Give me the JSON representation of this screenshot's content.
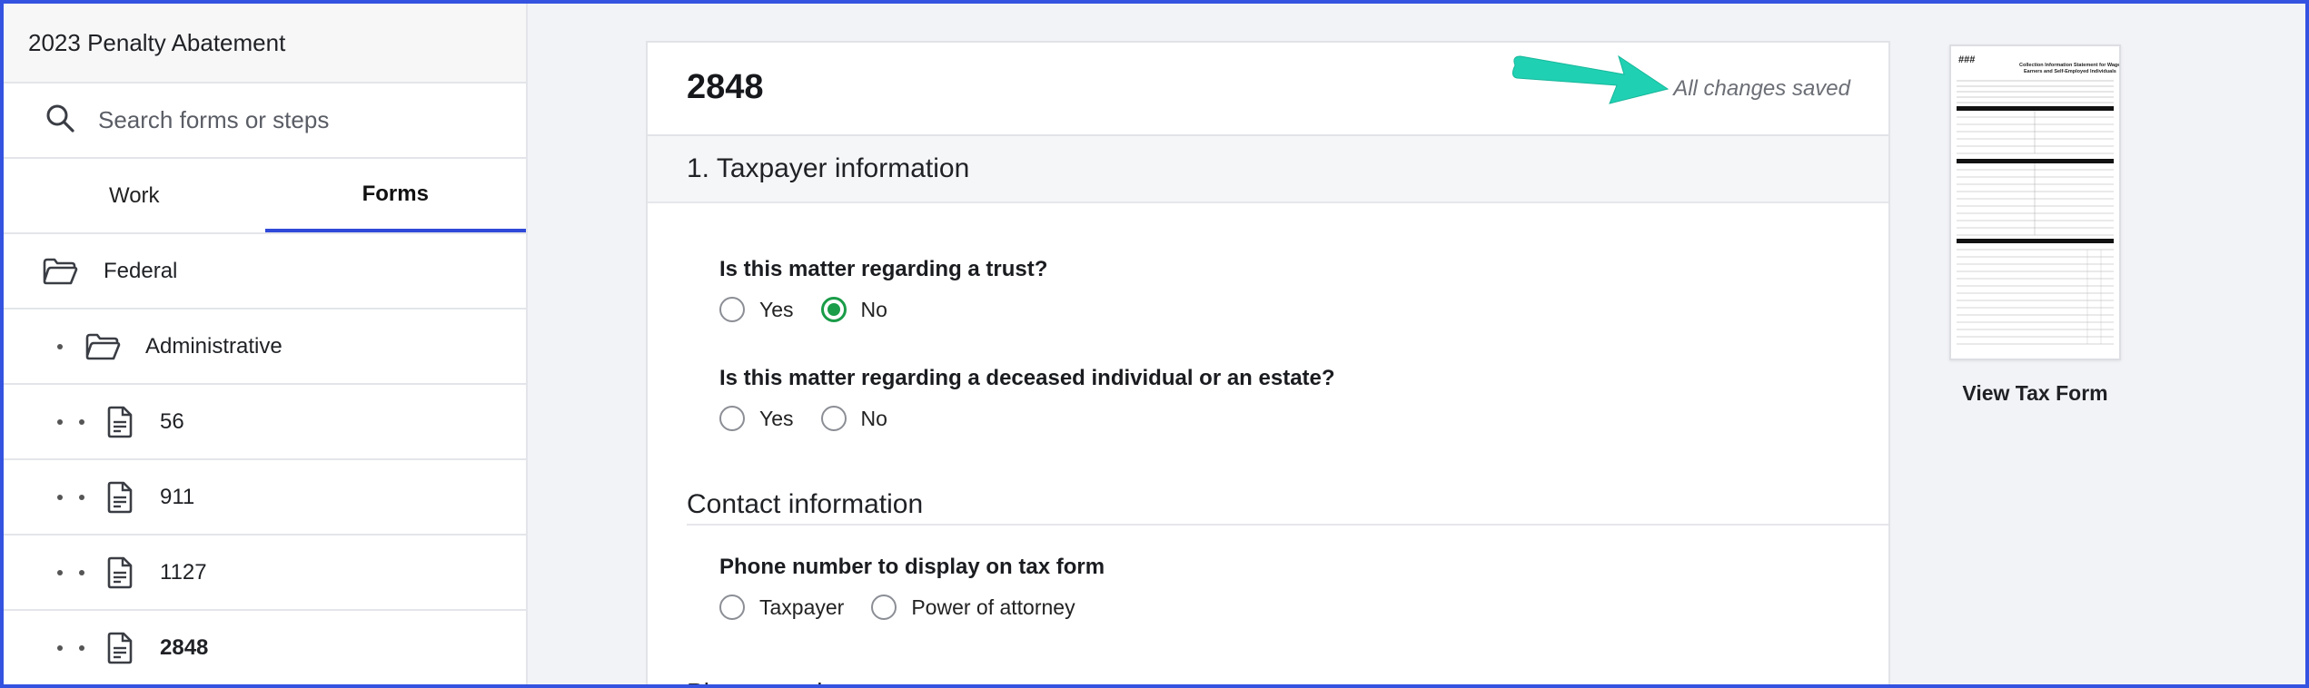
{
  "sidebar": {
    "title": "2023 Penalty Abatement",
    "search": {
      "placeholder": "Search forms or steps"
    },
    "tabs": [
      {
        "label": "Work",
        "active": false
      },
      {
        "label": "Forms",
        "active": true
      }
    ],
    "items": [
      {
        "label": "Federal",
        "icon": "folder-open-icon",
        "level": 0
      },
      {
        "label": "Administrative",
        "icon": "folder-open-icon",
        "level": 1
      },
      {
        "label": "56",
        "icon": "document-icon",
        "level": 2
      },
      {
        "label": "911",
        "icon": "document-icon",
        "level": 2
      },
      {
        "label": "1127",
        "icon": "document-icon",
        "level": 2
      },
      {
        "label": "2848",
        "icon": "document-icon",
        "level": 2,
        "selected": true
      }
    ]
  },
  "main": {
    "form_title": "2848",
    "save_status": "All changes saved",
    "section1": {
      "title": "1. Taxpayer information"
    },
    "questions": [
      {
        "label": "Is this matter regarding a trust?",
        "options": [
          "Yes",
          "No"
        ],
        "selected": "No"
      },
      {
        "label": "Is this matter regarding a deceased individual or an estate?",
        "options": [
          "Yes",
          "No"
        ],
        "selected": null
      }
    ],
    "contact": {
      "title": "Contact information",
      "phone_question": "Phone number to display on tax form",
      "phone_options": [
        "Taxpayer",
        "Power of attorney"
      ],
      "next_section_partial": "Phone number"
    }
  },
  "tax_form_preview": {
    "label": "View Tax Form",
    "form_header": "###",
    "form_title": "Collection Information Statement for Wage Earners and Self-Employed Individuals"
  },
  "colors": {
    "accent": "#2f49d8",
    "selected_radio": "#1a9c48",
    "annotation_arrow": "#1fd1b2",
    "frame": "#3453e0"
  }
}
